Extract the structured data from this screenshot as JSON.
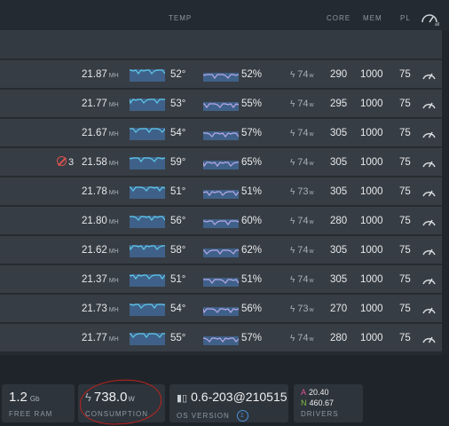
{
  "header": {
    "temp": "TEMP",
    "core": "CORE",
    "mem": "MEM",
    "pl": "PL",
    "tune_icon_label": "all"
  },
  "rows": [
    {
      "hash": "21.87",
      "unit": "MH",
      "temp": "52°",
      "fan": "52%",
      "watts": "74",
      "wunit": "w",
      "core": "290",
      "mem": "1000",
      "pl": "75"
    },
    {
      "hash": "21.77",
      "unit": "MH",
      "temp": "53°",
      "fan": "55%",
      "watts": "74",
      "wunit": "w",
      "core": "295",
      "mem": "1000",
      "pl": "75"
    },
    {
      "hash": "21.67",
      "unit": "MH",
      "temp": "54°",
      "fan": "57%",
      "watts": "74",
      "wunit": "w",
      "core": "305",
      "mem": "1000",
      "pl": "75"
    },
    {
      "hash": "21.58",
      "unit": "MH",
      "temp": "59°",
      "fan": "65%",
      "watts": "74",
      "wunit": "w",
      "core": "305",
      "mem": "1000",
      "pl": "75",
      "errors": "3"
    },
    {
      "hash": "21.78",
      "unit": "MH",
      "temp": "51°",
      "fan": "51%",
      "watts": "73",
      "wunit": "w",
      "core": "305",
      "mem": "1000",
      "pl": "75"
    },
    {
      "hash": "21.80",
      "unit": "MH",
      "temp": "56°",
      "fan": "60%",
      "watts": "74",
      "wunit": "w",
      "core": "280",
      "mem": "1000",
      "pl": "75"
    },
    {
      "hash": "21.62",
      "unit": "MH",
      "temp": "58°",
      "fan": "62%",
      "watts": "74",
      "wunit": "w",
      "core": "305",
      "mem": "1000",
      "pl": "75"
    },
    {
      "hash": "21.37",
      "unit": "MH",
      "temp": "51°",
      "fan": "51%",
      "watts": "74",
      "wunit": "w",
      "core": "305",
      "mem": "1000",
      "pl": "75"
    },
    {
      "hash": "21.73",
      "unit": "MH",
      "temp": "54°",
      "fan": "56%",
      "watts": "73",
      "wunit": "w",
      "core": "270",
      "mem": "1000",
      "pl": "75"
    },
    {
      "hash": "21.77",
      "unit": "MH",
      "temp": "55°",
      "fan": "57%",
      "watts": "74",
      "wunit": "w",
      "core": "280",
      "mem": "1000",
      "pl": "75"
    }
  ],
  "cards": {
    "ram": {
      "value": "1.2",
      "unit": "Gb",
      "label": "FREE RAM"
    },
    "consumption": {
      "value": "738.0",
      "unit": "w",
      "label": "CONSUMPTION"
    },
    "os": {
      "value": "0.6-203@210515",
      "label": "OS VERSION",
      "badge": "1"
    },
    "drivers": {
      "a_key": "A",
      "a_val": "20.40",
      "n_key": "N",
      "n_val": "460.67",
      "label": "DRIVERS"
    }
  },
  "colors": {
    "accent_a": "#e0559a",
    "accent_n": "#7fc241",
    "error": "#d9534f",
    "annotation": "#c0231e"
  }
}
